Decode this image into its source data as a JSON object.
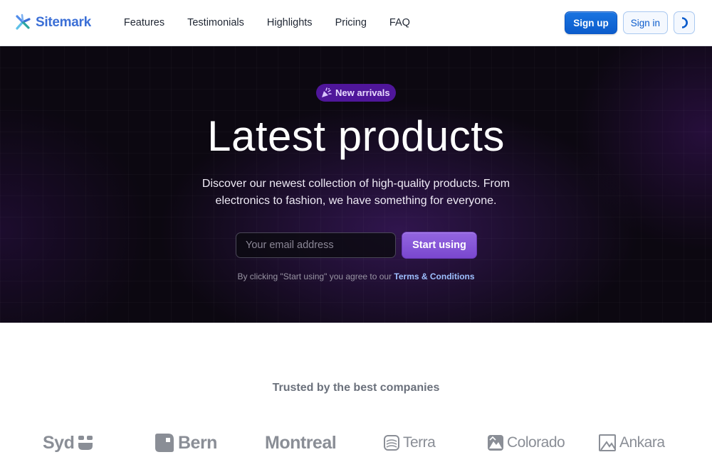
{
  "brand": {
    "name": "Sitemark"
  },
  "nav": {
    "items": [
      "Features",
      "Testimonials",
      "Highlights",
      "Pricing",
      "FAQ"
    ]
  },
  "header_actions": {
    "sign_up": "Sign up",
    "sign_in": "Sign in",
    "theme_icon": "half-moon-icon"
  },
  "hero": {
    "badge": "New arrivals",
    "badge_icon": "party-popper-icon",
    "title": "Latest products",
    "subtitle": "Discover our newest collection of high-quality products. From electronics to fashion, we have something for everyone.",
    "email_placeholder": "Your email address",
    "cta": "Start using",
    "terms_prefix": "By clicking \"Start using\" you agree to our ",
    "terms_link": "Terms & Conditions"
  },
  "trusted": {
    "title": "Trusted by the best companies",
    "companies": [
      "Syd",
      "Bern",
      "Montreal",
      "Terra",
      "Colorado",
      "Ankara"
    ]
  },
  "colors": {
    "brand_blue": "#3b6fd6",
    "primary_button": "#0b5ccc",
    "hero_bg": "#0c0811",
    "accent_purple": "#7a47cf",
    "badge_bg": "#4f169a",
    "link": "#9ec0ff",
    "logo_gray": "#8a8e96"
  }
}
